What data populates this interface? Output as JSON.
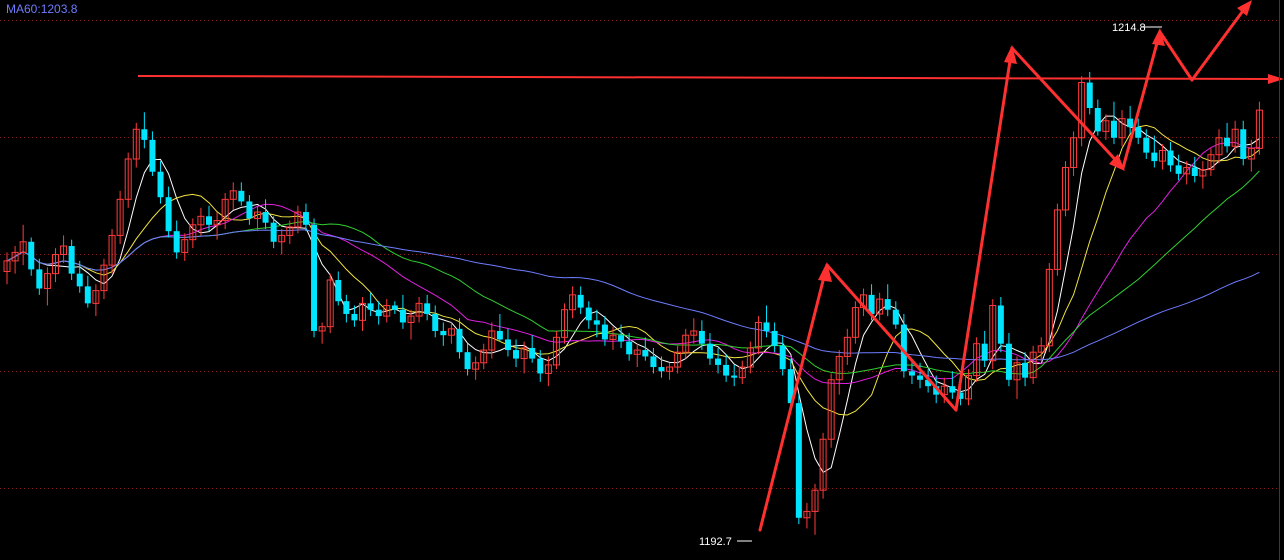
{
  "indicator": {
    "ma_label": "MA60",
    "ma_value": "1203.8"
  },
  "annotations": {
    "high_label": "1214.8",
    "low_label": "1192.7"
  },
  "colors": {
    "up": "#ff3b3b",
    "down": "#00e5ff",
    "ma5": "#ffffff",
    "ma10": "#f0e442",
    "ma20": "#e020e0",
    "ma30": "#30d030",
    "ma60": "#6e7cff",
    "trend": "#ff3030",
    "grid": "#8a1a1a"
  },
  "chart_data": {
    "type": "candlestick",
    "ylim": [
      1192,
      1218
    ],
    "grid": true,
    "x": [
      1,
      2,
      3,
      4,
      5,
      6,
      7,
      8,
      9,
      10,
      11,
      12,
      13,
      14,
      15,
      16,
      17,
      18,
      19,
      20,
      21,
      22,
      23,
      24,
      25,
      26,
      27,
      28,
      29,
      30,
      31,
      32,
      33,
      34,
      35,
      36,
      37,
      38,
      39,
      40,
      41,
      42,
      43,
      44,
      45,
      46,
      47,
      48,
      48.5,
      49,
      50,
      51,
      52,
      53,
      54,
      55,
      56,
      57,
      58,
      59,
      60,
      61,
      62,
      63,
      64,
      65,
      66,
      67,
      68,
      69,
      70,
      71,
      72,
      73,
      74,
      75,
      76,
      77,
      78,
      79,
      80,
      81,
      82,
      83,
      84,
      85,
      86,
      87,
      88,
      89,
      90,
      91,
      92,
      93,
      94,
      95,
      96,
      97,
      98,
      99,
      100,
      101,
      102,
      103,
      104,
      105,
      106,
      107,
      108,
      109,
      110,
      111,
      112,
      113,
      114,
      115,
      116,
      117,
      118,
      119,
      120,
      121,
      122,
      123,
      124,
      125,
      126,
      127,
      128,
      129,
      130,
      131,
      132,
      133,
      134,
      135,
      136,
      137,
      138,
      139,
      140,
      141,
      142,
      143,
      144,
      145,
      146,
      147,
      148,
      149,
      150,
      151,
      152,
      153,
      154,
      155,
      156,
      157,
      158,
      159,
      160,
      161,
      162,
      163,
      164,
      165,
      166,
      167,
      168,
      169,
      170,
      171,
      172,
      173,
      174,
      175,
      176,
      177,
      178,
      179,
      180,
      181,
      182,
      183,
      184,
      185,
      186,
      187,
      188,
      189,
      190,
      191,
      192,
      193,
      194
    ],
    "series": [
      {
        "name": "MA60",
        "values": []
      }
    ],
    "candles": [
      [
        1205.4,
        1206.3,
        1204.8,
        1205.9
      ],
      [
        1205.9,
        1206.6,
        1205.3,
        1206.3
      ],
      [
        1206.3,
        1207.6,
        1205.7,
        1206.8
      ],
      [
        1206.8,
        1207.0,
        1205.2,
        1205.5
      ],
      [
        1205.5,
        1206.0,
        1204.3,
        1204.6
      ],
      [
        1204.6,
        1205.6,
        1203.8,
        1205.3
      ],
      [
        1205.3,
        1206.5,
        1204.9,
        1206.2
      ],
      [
        1206.2,
        1207.1,
        1205.8,
        1206.6
      ],
      [
        1206.6,
        1206.9,
        1205.0,
        1205.3
      ],
      [
        1205.3,
        1205.9,
        1204.4,
        1204.7
      ],
      [
        1204.7,
        1205.2,
        1203.7,
        1203.9
      ],
      [
        1203.9,
        1204.8,
        1203.3,
        1204.5
      ],
      [
        1204.5,
        1206.0,
        1204.1,
        1205.7
      ],
      [
        1205.7,
        1207.4,
        1205.3,
        1207.1
      ],
      [
        1207.1,
        1209.2,
        1206.7,
        1208.8
      ],
      [
        1208.8,
        1211.0,
        1208.4,
        1210.7
      ],
      [
        1210.7,
        1212.4,
        1210.3,
        1212.1
      ],
      [
        1212.1,
        1212.9,
        1211.2,
        1211.6
      ],
      [
        1211.6,
        1212.0,
        1209.9,
        1210.1
      ],
      [
        1210.1,
        1210.6,
        1208.6,
        1208.9
      ],
      [
        1208.9,
        1209.4,
        1207.0,
        1207.3
      ],
      [
        1207.3,
        1207.8,
        1206.0,
        1206.3
      ],
      [
        1206.3,
        1207.2,
        1205.9,
        1206.9
      ],
      [
        1206.9,
        1207.9,
        1206.5,
        1207.6
      ],
      [
        1207.6,
        1208.4,
        1207.1,
        1208.0
      ],
      [
        1208.0,
        1208.5,
        1207.3,
        1207.6
      ],
      [
        1207.6,
        1208.2,
        1206.9,
        1207.8
      ],
      [
        1207.8,
        1209.1,
        1207.4,
        1208.8
      ],
      [
        1208.8,
        1209.6,
        1208.3,
        1209.2
      ],
      [
        1209.2,
        1209.6,
        1208.5,
        1208.7
      ],
      [
        1208.7,
        1209.0,
        1207.6,
        1207.9
      ],
      [
        1207.9,
        1208.5,
        1207.3,
        1208.2
      ],
      [
        1208.2,
        1208.8,
        1207.4,
        1207.7
      ],
      [
        1207.7,
        1208.0,
        1206.5,
        1206.8
      ],
      [
        1206.8,
        1207.4,
        1206.2,
        1207.1
      ],
      [
        1207.1,
        1207.8,
        1206.7,
        1207.5
      ],
      [
        1207.5,
        1208.5,
        1207.2,
        1208.2
      ],
      [
        1208.2,
        1208.6,
        1207.3,
        1207.6
      ],
      [
        1207.6,
        1207.9,
        1202.3,
        1202.6
      ],
      [
        1202.6,
        1203.0,
        1202.0,
        1202.8
      ],
      [
        1202.8,
        1205.3,
        1202.5,
        1205.0
      ],
      [
        1205.0,
        1205.4,
        1203.8,
        1204.0
      ],
      [
        1204.0,
        1204.3,
        1203.0,
        1203.4
      ],
      [
        1203.4,
        1203.8,
        1202.8,
        1203.1
      ],
      [
        1203.1,
        1204.2,
        1202.6,
        1203.9
      ],
      [
        1203.9,
        1204.4,
        1203.3,
        1203.6
      ],
      [
        1203.6,
        1204.0,
        1202.9,
        1203.3
      ],
      [
        1203.3,
        1204.1,
        1203.0,
        1203.8
      ],
      [
        1203.8,
        1204.0,
        1203.4,
        1203.6
      ],
      [
        1203.6,
        1204.3,
        1202.7,
        1203.0
      ],
      [
        1203.0,
        1203.6,
        1202.2,
        1203.3
      ],
      [
        1203.3,
        1204.2,
        1203.0,
        1203.9
      ],
      [
        1203.9,
        1204.3,
        1203.1,
        1203.4
      ],
      [
        1203.4,
        1203.8,
        1202.3,
        1202.6
      ],
      [
        1202.6,
        1203.0,
        1201.9,
        1202.4
      ],
      [
        1202.4,
        1203.0,
        1202.0,
        1202.7
      ],
      [
        1202.7,
        1203.2,
        1201.3,
        1201.6
      ],
      [
        1201.6,
        1202.0,
        1200.5,
        1200.8
      ],
      [
        1200.8,
        1201.4,
        1200.3,
        1201.1
      ],
      [
        1201.1,
        1202.0,
        1200.8,
        1201.7
      ],
      [
        1201.7,
        1203.0,
        1201.3,
        1202.6
      ],
      [
        1202.6,
        1203.4,
        1202.1,
        1202.2
      ],
      [
        1202.2,
        1202.7,
        1201.4,
        1201.7
      ],
      [
        1201.7,
        1202.2,
        1200.9,
        1201.3
      ],
      [
        1201.3,
        1202.1,
        1200.6,
        1201.8
      ],
      [
        1201.8,
        1202.4,
        1201.1,
        1201.3
      ],
      [
        1201.3,
        1201.7,
        1200.2,
        1200.6
      ],
      [
        1200.6,
        1201.4,
        1200.0,
        1201.0
      ],
      [
        1201.0,
        1202.6,
        1200.8,
        1202.3
      ],
      [
        1202.3,
        1203.9,
        1202.0,
        1203.6
      ],
      [
        1203.6,
        1204.7,
        1203.2,
        1204.3
      ],
      [
        1204.3,
        1204.7,
        1203.4,
        1203.7
      ],
      [
        1203.7,
        1204.0,
        1202.7,
        1203.1
      ],
      [
        1203.1,
        1203.6,
        1202.3,
        1202.9
      ],
      [
        1202.9,
        1203.3,
        1201.9,
        1202.2
      ],
      [
        1202.2,
        1202.8,
        1201.7,
        1202.4
      ],
      [
        1202.4,
        1202.9,
        1201.8,
        1202.1
      ],
      [
        1202.1,
        1202.5,
        1201.2,
        1201.5
      ],
      [
        1201.5,
        1202.0,
        1200.9,
        1201.7
      ],
      [
        1201.7,
        1202.3,
        1201.2,
        1201.4
      ],
      [
        1201.4,
        1201.8,
        1200.6,
        1200.9
      ],
      [
        1200.9,
        1201.4,
        1200.4,
        1200.7
      ],
      [
        1200.7,
        1201.1,
        1200.3,
        1200.9
      ],
      [
        1200.9,
        1201.9,
        1200.6,
        1201.6
      ],
      [
        1201.6,
        1202.7,
        1201.3,
        1202.4
      ],
      [
        1202.4,
        1203.2,
        1202.0,
        1202.6
      ],
      [
        1202.6,
        1203.1,
        1201.7,
        1202.0
      ],
      [
        1202.0,
        1202.5,
        1201.0,
        1201.3
      ],
      [
        1201.3,
        1201.8,
        1200.6,
        1201.0
      ],
      [
        1201.0,
        1201.5,
        1200.2,
        1200.5
      ],
      [
        1200.5,
        1201.0,
        1200.0,
        1200.4
      ],
      [
        1200.4,
        1201.2,
        1200.1,
        1200.9
      ],
      [
        1200.9,
        1202.1,
        1200.6,
        1201.8
      ],
      [
        1201.8,
        1203.3,
        1201.5,
        1203.0
      ],
      [
        1203.0,
        1203.8,
        1202.3,
        1202.6
      ],
      [
        1202.6,
        1203.0,
        1201.6,
        1201.9
      ],
      [
        1201.9,
        1202.4,
        1200.5,
        1200.8
      ],
      [
        1200.8,
        1201.3,
        1198.9,
        1199.2
      ],
      [
        1199.2,
        1199.6,
        1193.5,
        1193.8
      ],
      [
        1193.8,
        1194.5,
        1193.3,
        1194.1
      ],
      [
        1194.1,
        1195.4,
        1193.0,
        1195.1
      ],
      [
        1195.1,
        1197.8,
        1194.7,
        1197.5
      ],
      [
        1197.5,
        1200.6,
        1197.1,
        1200.3
      ],
      [
        1200.3,
        1201.7,
        1199.6,
        1201.4
      ],
      [
        1201.4,
        1202.7,
        1201.0,
        1202.3
      ],
      [
        1202.3,
        1204.0,
        1202.0,
        1203.7
      ],
      [
        1203.7,
        1204.6,
        1203.3,
        1204.3
      ],
      [
        1204.3,
        1204.8,
        1203.1,
        1203.4
      ],
      [
        1203.4,
        1204.4,
        1203.1,
        1204.1
      ],
      [
        1204.1,
        1204.8,
        1203.3,
        1203.6
      ],
      [
        1203.6,
        1204.0,
        1202.7,
        1202.9
      ],
      [
        1202.9,
        1203.4,
        1200.4,
        1200.7
      ],
      [
        1200.7,
        1201.2,
        1200.1,
        1200.5
      ],
      [
        1200.5,
        1201.1,
        1199.9,
        1200.3
      ],
      [
        1200.3,
        1200.8,
        1199.7,
        1200.0
      ],
      [
        1200.0,
        1200.5,
        1199.2,
        1199.6
      ],
      [
        1199.6,
        1200.4,
        1199.2,
        1200.0
      ],
      [
        1200.0,
        1200.7,
        1199.4,
        1199.7
      ],
      [
        1199.7,
        1200.3,
        1199.1,
        1199.4
      ],
      [
        1199.4,
        1200.8,
        1199.1,
        1200.5
      ],
      [
        1200.5,
        1202.3,
        1200.2,
        1202.0
      ],
      [
        1202.0,
        1202.6,
        1200.9,
        1201.2
      ],
      [
        1201.2,
        1204.1,
        1200.8,
        1203.8
      ],
      [
        1203.8,
        1204.2,
        1201.6,
        1202.0
      ],
      [
        1202.0,
        1202.5,
        1200.0,
        1200.3
      ],
      [
        1200.3,
        1201.4,
        1199.4,
        1201.1
      ],
      [
        1201.1,
        1201.6,
        1200.0,
        1200.4
      ],
      [
        1200.4,
        1201.9,
        1200.1,
        1201.6
      ],
      [
        1201.6,
        1202.3,
        1201.2,
        1201.9
      ],
      [
        1201.9,
        1205.8,
        1201.6,
        1205.5
      ],
      [
        1205.5,
        1208.6,
        1205.2,
        1208.3
      ],
      [
        1208.3,
        1210.6,
        1208.0,
        1210.3
      ],
      [
        1210.3,
        1212.0,
        1209.9,
        1211.7
      ],
      [
        1211.7,
        1214.6,
        1211.3,
        1214.3
      ],
      [
        1214.3,
        1214.8,
        1212.8,
        1213.1
      ],
      [
        1213.1,
        1213.5,
        1211.8,
        1212.0
      ],
      [
        1212.0,
        1212.8,
        1211.6,
        1212.5
      ],
      [
        1212.5,
        1213.4,
        1211.4,
        1211.7
      ],
      [
        1211.7,
        1213.0,
        1211.3,
        1212.6
      ],
      [
        1212.6,
        1213.2,
        1211.9,
        1212.2
      ],
      [
        1212.2,
        1212.6,
        1211.4,
        1211.7
      ],
      [
        1211.7,
        1212.1,
        1210.7,
        1211.0
      ],
      [
        1211.0,
        1211.8,
        1210.3,
        1210.6
      ],
      [
        1210.6,
        1211.4,
        1210.2,
        1211.1
      ],
      [
        1211.1,
        1211.5,
        1210.1,
        1210.4
      ],
      [
        1210.4,
        1210.9,
        1209.7,
        1210.0
      ],
      [
        1210.0,
        1210.6,
        1209.5,
        1210.3
      ],
      [
        1210.3,
        1210.8,
        1209.6,
        1209.9
      ],
      [
        1209.9,
        1210.6,
        1209.3,
        1210.2
      ],
      [
        1210.2,
        1211.2,
        1209.9,
        1210.9
      ],
      [
        1210.9,
        1212.1,
        1210.5,
        1211.7
      ],
      [
        1211.7,
        1212.4,
        1211.0,
        1211.3
      ],
      [
        1211.3,
        1212.5,
        1211.0,
        1212.1
      ],
      [
        1212.1,
        1212.5,
        1210.4,
        1210.7
      ],
      [
        1210.7,
        1211.6,
        1210.1,
        1211.2
      ],
      [
        1211.2,
        1213.4,
        1210.9,
        1213.0
      ]
    ]
  }
}
